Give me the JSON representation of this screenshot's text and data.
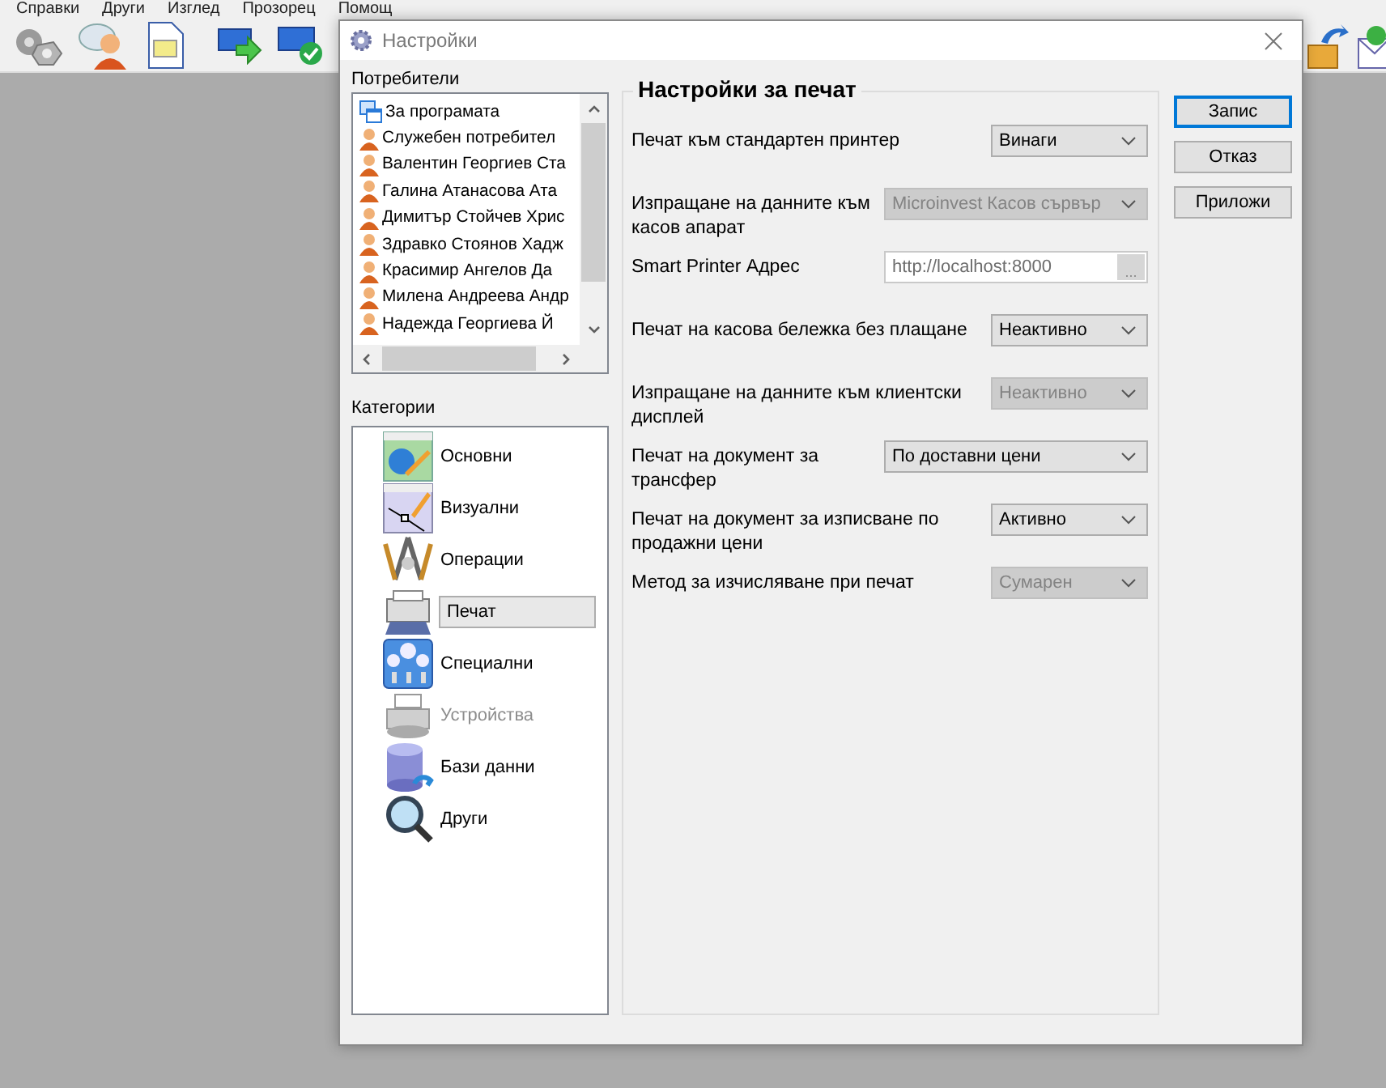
{
  "menu": [
    "Справки",
    "Други",
    "Изглед",
    "Прозорец",
    "Помощ"
  ],
  "dialog": {
    "title": "Настройки",
    "users_label": "Потребители",
    "users": [
      {
        "name": "За програмата",
        "kind": "program"
      },
      {
        "name": "Служебен потребител",
        "kind": "user"
      },
      {
        "name": "Валентин Георгиев Ста",
        "kind": "user"
      },
      {
        "name": "Галина Атанасова Ата",
        "kind": "user"
      },
      {
        "name": "Димитър Стойчев Хрис",
        "kind": "user"
      },
      {
        "name": "Здравко Стоянов Хадж",
        "kind": "user"
      },
      {
        "name": "Красимир Ангелов Да",
        "kind": "user"
      },
      {
        "name": "Милена Андреева Андр",
        "kind": "user"
      },
      {
        "name": "Надежда Георгиева Й",
        "kind": "user"
      }
    ],
    "categories_label": "Категории",
    "categories": [
      {
        "label": "Основни",
        "kind": "basic",
        "selected": false,
        "disabled": false
      },
      {
        "label": "Визуални",
        "kind": "visual",
        "selected": false,
        "disabled": false
      },
      {
        "label": "Операции",
        "kind": "operations",
        "selected": false,
        "disabled": false
      },
      {
        "label": "Печат",
        "kind": "printing",
        "selected": true,
        "disabled": false
      },
      {
        "label": "Специални",
        "kind": "special",
        "selected": false,
        "disabled": false
      },
      {
        "label": "Устройства",
        "kind": "devices",
        "selected": false,
        "disabled": true
      },
      {
        "label": "Бази данни",
        "kind": "database",
        "selected": false,
        "disabled": false
      },
      {
        "label": "Други",
        "kind": "other",
        "selected": false,
        "disabled": false
      }
    ],
    "panel_title": "Настройки за печат",
    "settings": [
      {
        "label": "Печат към стандартен принтер",
        "kind": "select",
        "value": "Винаги",
        "disabled": false
      },
      {
        "label": "Изпращане на данните към касов апарат",
        "kind": "wide-select",
        "value": "Microinvest Касов сървър",
        "disabled": true
      },
      {
        "label": "Smart Printer Адрес",
        "kind": "address",
        "value": "http://localhost:8000",
        "browse": "...",
        "disabled": true
      },
      {
        "label": "Печат на касова бележка без плащане",
        "kind": "select",
        "value": "Неактивно",
        "disabled": false
      },
      {
        "label": "Изпращане на данните към клиентски дисплей",
        "kind": "select",
        "value": "Неактивно",
        "disabled": true
      },
      {
        "label": "Печат на документ за трансфер",
        "kind": "wide-select",
        "value": "По доставни цени",
        "disabled": false
      },
      {
        "label": "Печат на документ за изписване по продажни цени",
        "kind": "select",
        "value": "Активно",
        "disabled": false
      },
      {
        "label": "Метод за изчисляване при печат",
        "kind": "select",
        "value": "Сумарен",
        "disabled": true
      }
    ],
    "buttons": [
      {
        "label": "Запис",
        "focused": true
      },
      {
        "label": "Отказ",
        "focused": false
      },
      {
        "label": "Приложи",
        "focused": false
      }
    ]
  }
}
